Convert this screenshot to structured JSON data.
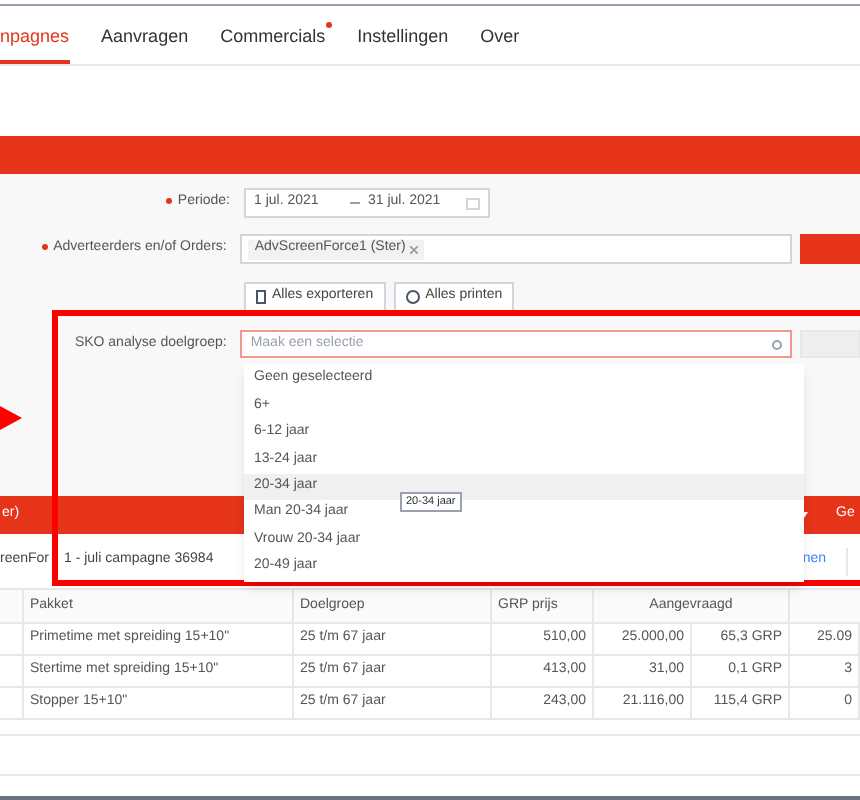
{
  "tabs": [
    {
      "label": "npagnes",
      "selected": true,
      "notification": false
    },
    {
      "label": "Aanvragen",
      "selected": false,
      "notification": false
    },
    {
      "label": "Commercials",
      "selected": false,
      "notification": true
    },
    {
      "label": "Instellingen",
      "selected": false,
      "notification": false
    },
    {
      "label": "Over",
      "selected": false,
      "notification": false
    }
  ],
  "form": {
    "period": {
      "label": "Periode:",
      "required": true,
      "start": "1 jul. 2021",
      "end": "31 jul. 2021"
    },
    "advertisers": {
      "label": "Adverteerders en/of Orders:",
      "required": true,
      "tags": [
        "AdvScreenForce1 (Ster)"
      ]
    },
    "buttons": [
      "Alles exporteren",
      "Alles printen"
    ],
    "audience": {
      "label": "SKO analyse doelgroep:",
      "placeholder": "Maak een selectie",
      "tooltip": "20-34 jaar",
      "options": [
        {
          "label": "Geen geselecteerd",
          "hovered": false
        },
        {
          "label": "6+",
          "hovered": false
        },
        {
          "label": "6-12 jaar",
          "hovered": false
        },
        {
          "label": "13-24 jaar",
          "hovered": false
        },
        {
          "label": "20-34 jaar",
          "hovered": true
        },
        {
          "label": "Man 20-34 jaar",
          "hovered": false
        },
        {
          "label": "Vrouw 20-34 jaar",
          "hovered": false
        },
        {
          "label": "20-49 jaar",
          "hovered": false
        }
      ]
    }
  },
  "results_bar": {
    "left": "er)",
    "right": "Ge"
  },
  "campaign": {
    "title_parts": [
      "reenFor",
      "1 - juli campagne 36984"
    ],
    "link": "nen"
  },
  "table": {
    "columns": [
      "Pakket",
      "Doelgroep",
      "GRP prijs",
      "Aangevraagd"
    ],
    "rows": [
      [
        "Primetime met spreiding 15+10\"",
        "25 t/m 67 jaar",
        "510,00",
        "25.000,00",
        "65,3 GRP",
        "25.09"
      ],
      [
        "Stertime met spreiding 15+10\"",
        "25 t/m 67 jaar",
        "413,00",
        "31,00",
        "0,1 GRP",
        "3"
      ],
      [
        "Stopper 15+10\"",
        "25 t/m 67 jaar",
        "243,00",
        "21.116,00",
        "115,4 GRP",
        "0"
      ]
    ]
  }
}
